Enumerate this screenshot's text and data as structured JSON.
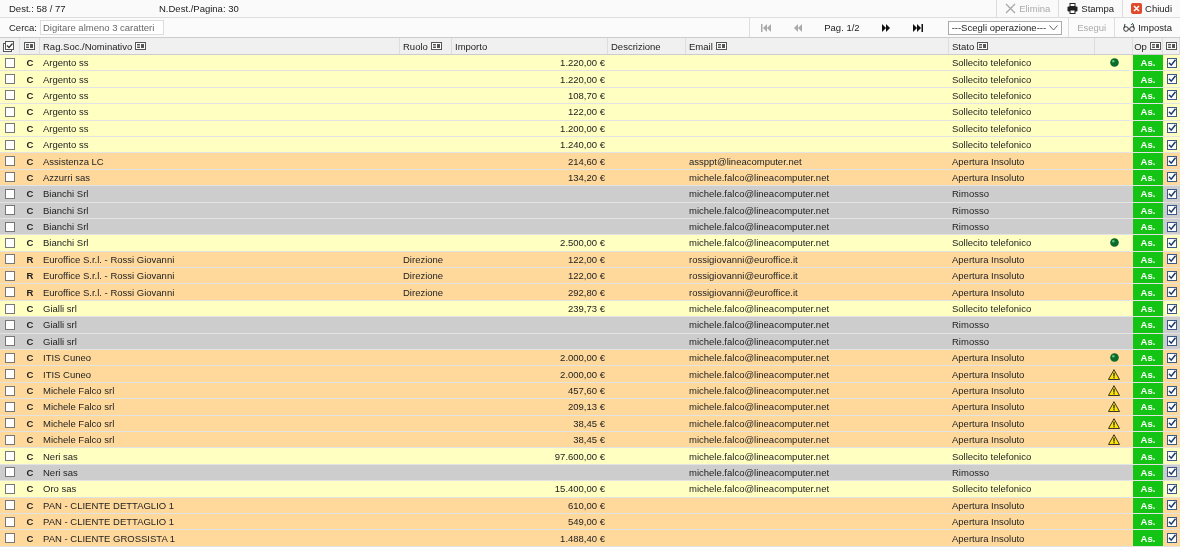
{
  "summary": {
    "count": "Dest.: 58 / 77",
    "per_page": "N.Dest./Pagina: 30"
  },
  "actions": [
    {
      "label": "Elimina",
      "kind": "delete",
      "disabled": true
    },
    {
      "label": "Stampa",
      "kind": "print",
      "disabled": false
    },
    {
      "label": "Chiudi",
      "kind": "close",
      "disabled": false
    }
  ],
  "search": {
    "label": "Cerca:",
    "placeholder": "Digitare almeno 3 caratteri"
  },
  "pager": {
    "page": "Pag. 1/2",
    "first_disabled": true,
    "prev_disabled": true
  },
  "operation": {
    "value": "---Scegli operazione---",
    "run": "Esegui",
    "run_disabled": true,
    "settings": "Imposta"
  },
  "columns": [
    {
      "label": "Rag.Soc./Nominativo",
      "menu": true
    },
    {
      "label": "Ruolo",
      "menu": true
    },
    {
      "label": "Importo",
      "menu": false
    },
    {
      "label": "Descrizione",
      "menu": false
    },
    {
      "label": "Email",
      "menu": true
    },
    {
      "label": "Stato",
      "menu": true
    },
    {
      "label": "Op",
      "menu": true
    }
  ],
  "rows": [
    {
      "type": "C",
      "name": "Argento ss",
      "amount": "1.220,00 €",
      "status": "Sollecito telefonico",
      "kind": "reminder",
      "dot": true,
      "checked": false,
      "confirmed": true,
      "op": "As."
    },
    {
      "type": "C",
      "name": "Argento ss",
      "amount": "1.220,00 €",
      "status": "Sollecito telefonico",
      "kind": "reminder",
      "checked": false,
      "confirmed": true,
      "op": "As."
    },
    {
      "type": "C",
      "name": "Argento ss",
      "amount": "108,70 €",
      "status": "Sollecito telefonico",
      "kind": "reminder",
      "checked": false,
      "confirmed": true,
      "op": "As."
    },
    {
      "type": "C",
      "name": "Argento ss",
      "amount": "122,00 €",
      "status": "Sollecito telefonico",
      "kind": "reminder",
      "checked": false,
      "confirmed": true,
      "op": "As."
    },
    {
      "type": "C",
      "name": "Argento ss",
      "amount": "1.200,00 €",
      "status": "Sollecito telefonico",
      "kind": "reminder",
      "checked": false,
      "confirmed": true,
      "op": "As."
    },
    {
      "type": "C",
      "name": "Argento ss",
      "amount": "1.240,00 €",
      "status": "Sollecito telefonico",
      "kind": "reminder",
      "checked": false,
      "confirmed": true,
      "op": "As."
    },
    {
      "type": "C",
      "name": "Assistenza LC",
      "amount": "214,60 €",
      "email": "assppt@lineacomputer.net",
      "status": "Apertura Insoluto",
      "kind": "open",
      "checked": false,
      "confirmed": true,
      "op": "As."
    },
    {
      "type": "C",
      "name": "Azzurri sas",
      "amount": "134,20 €",
      "email": "michele.falco@lineacomputer.net",
      "status": "Apertura Insoluto",
      "kind": "open",
      "checked": false,
      "confirmed": true,
      "op": "As."
    },
    {
      "type": "C",
      "name": "Bianchi Srl",
      "email": "michele.falco@lineacomputer.net",
      "status": "Rimosso",
      "kind": "removed",
      "checked": false,
      "confirmed": true,
      "op": "As."
    },
    {
      "type": "C",
      "name": "Bianchi Srl",
      "email": "michele.falco@lineacomputer.net",
      "status": "Rimosso",
      "kind": "removed",
      "checked": false,
      "confirmed": true,
      "op": "As."
    },
    {
      "type": "C",
      "name": "Bianchi Srl",
      "email": "michele.falco@lineacomputer.net",
      "status": "Rimosso",
      "kind": "removed",
      "checked": false,
      "confirmed": true,
      "op": "As."
    },
    {
      "type": "C",
      "name": "Bianchi Srl",
      "amount": "2.500,00 €",
      "email": "michele.falco@lineacomputer.net",
      "status": "Sollecito telefonico",
      "kind": "reminder",
      "dot": true,
      "checked": false,
      "confirmed": true,
      "op": "As."
    },
    {
      "type": "R",
      "name": "Euroffice S.r.l. - Rossi Giovanni",
      "role": "Direzione",
      "amount": "122,00 €",
      "email": "rossigiovanni@euroffice.it",
      "status": "Apertura Insoluto",
      "kind": "open",
      "checked": false,
      "confirmed": true,
      "op": "As."
    },
    {
      "type": "R",
      "name": "Euroffice S.r.l. - Rossi Giovanni",
      "role": "Direzione",
      "amount": "122,00 €",
      "email": "rossigiovanni@euroffice.it",
      "status": "Apertura Insoluto",
      "kind": "open",
      "checked": false,
      "confirmed": true,
      "op": "As."
    },
    {
      "type": "R",
      "name": "Euroffice S.r.l. - Rossi Giovanni",
      "role": "Direzione",
      "amount": "292,80 €",
      "email": "rossigiovanni@euroffice.it",
      "status": "Apertura Insoluto",
      "kind": "open",
      "checked": false,
      "confirmed": true,
      "op": "As."
    },
    {
      "type": "C",
      "name": "Gialli srl",
      "amount": "239,73 €",
      "email": "michele.falco@lineacomputer.net",
      "status": "Sollecito telefonico",
      "kind": "reminder",
      "checked": false,
      "confirmed": true,
      "op": "As."
    },
    {
      "type": "C",
      "name": "Gialli srl",
      "email": "michele.falco@lineacomputer.net",
      "status": "Rimosso",
      "kind": "removed",
      "checked": false,
      "confirmed": true,
      "op": "As."
    },
    {
      "type": "C",
      "name": "Gialli srl",
      "email": "michele.falco@lineacomputer.net",
      "status": "Rimosso",
      "kind": "removed",
      "checked": false,
      "confirmed": true,
      "op": "As."
    },
    {
      "type": "C",
      "name": "ITIS Cuneo",
      "amount": "2.000,00 €",
      "email": "michele.falco@lineacomputer.net",
      "status": "Apertura Insoluto",
      "kind": "open",
      "dot": true,
      "checked": false,
      "confirmed": true,
      "op": "As."
    },
    {
      "type": "C",
      "name": "ITIS Cuneo",
      "amount": "2.000,00 €",
      "email": "michele.falco@lineacomputer.net",
      "status": "Apertura Insoluto",
      "kind": "open",
      "warning": true,
      "checked": false,
      "confirmed": true,
      "op": "As."
    },
    {
      "type": "C",
      "name": "Michele Falco srl",
      "amount": "457,60 €",
      "email": "michele.falco@lineacomputer.net",
      "status": "Apertura Insoluto",
      "kind": "open",
      "warning": true,
      "checked": false,
      "confirmed": true,
      "op": "As."
    },
    {
      "type": "C",
      "name": "Michele Falco srl",
      "amount": "209,13 €",
      "email": "michele.falco@lineacomputer.net",
      "status": "Apertura Insoluto",
      "kind": "open",
      "warning": true,
      "checked": false,
      "confirmed": true,
      "op": "As."
    },
    {
      "type": "C",
      "name": "Michele Falco srl",
      "amount": "38,45 €",
      "email": "michele.falco@lineacomputer.net",
      "status": "Apertura Insoluto",
      "kind": "open",
      "warning": true,
      "checked": false,
      "confirmed": true,
      "op": "As."
    },
    {
      "type": "C",
      "name": "Michele Falco srl",
      "amount": "38,45 €",
      "email": "michele.falco@lineacomputer.net",
      "status": "Apertura Insoluto",
      "kind": "open",
      "warning": true,
      "checked": false,
      "confirmed": true,
      "op": "As."
    },
    {
      "type": "C",
      "name": "Neri sas",
      "amount": "97.600,00 €",
      "email": "michele.falco@lineacomputer.net",
      "status": "Sollecito telefonico",
      "kind": "reminder",
      "checked": false,
      "confirmed": true,
      "op": "As."
    },
    {
      "type": "C",
      "name": "Neri sas",
      "email": "michele.falco@lineacomputer.net",
      "status": "Rimosso",
      "kind": "removed",
      "checked": false,
      "confirmed": true,
      "op": "As."
    },
    {
      "type": "C",
      "name": "Oro sas",
      "amount": "15.400,00 €",
      "email": "michele.falco@lineacomputer.net",
      "status": "Sollecito telefonico",
      "kind": "reminder",
      "checked": false,
      "confirmed": true,
      "op": "As."
    },
    {
      "type": "C",
      "name": "PAN - CLIENTE DETTAGLIO 1",
      "amount": "610,00 €",
      "status": "Apertura Insoluto",
      "kind": "open",
      "checked": false,
      "confirmed": true,
      "op": "As."
    },
    {
      "type": "C",
      "name": "PAN - CLIENTE DETTAGLIO 1",
      "amount": "549,00 €",
      "status": "Apertura Insoluto",
      "kind": "open",
      "checked": false,
      "confirmed": true,
      "op": "As."
    },
    {
      "type": "C",
      "name": "PAN - CLIENTE GROSSISTA 1",
      "amount": "1.488,40 €",
      "status": "Apertura Insoluto",
      "kind": "open",
      "checked": false,
      "confirmed": true,
      "op": "As."
    }
  ]
}
